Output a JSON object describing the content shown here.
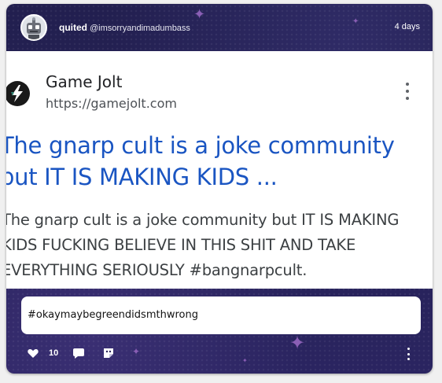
{
  "post": {
    "author_name": "quited",
    "author_handle": "@imsorryandimadumbass",
    "timestamp": "4 days",
    "caption": "#okaymaybegreendidsmthwrong",
    "like_count": "10"
  },
  "embed": {
    "site_name": "Game Jolt",
    "site_url": "https://gamejolt.com",
    "title_lines": [
      "The gnarp cult is a joke community",
      "but IT IS MAKING KIDS ..."
    ],
    "snippet_lines": [
      "The gnarp cult is a joke community but IT IS MAKING",
      "KIDS FUCKING BELIEVE IN THIS SHIT AND TAKE",
      "EVERYTHING SERIOUSLY #bangnarpcult."
    ]
  },
  "icons": {
    "avatar": "robot-avatar",
    "site_logo": "gamejolt-bolt-logo",
    "embed_menu": "kebab-vertical-icon",
    "like": "heart-icon",
    "comment": "comment-bubble-icon",
    "sticker": "sticker-icon",
    "more": "kebab-vertical-icon"
  },
  "colors": {
    "card_background": "#262257",
    "link_title": "#1a55c2",
    "snippet_text": "#3c4043",
    "sparkle": "#8a5fb5"
  }
}
